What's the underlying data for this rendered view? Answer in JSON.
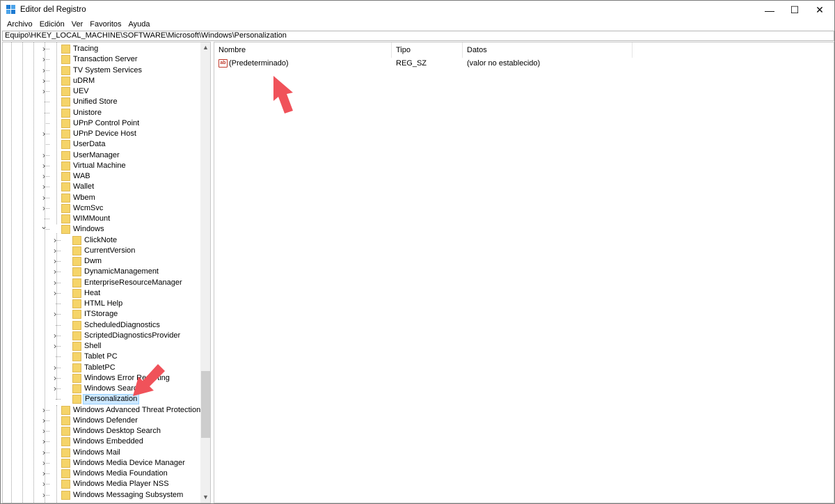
{
  "window": {
    "title": "Editor del Registro",
    "minimize_glyph": "—",
    "maximize_glyph": "☐",
    "close_glyph": "✕"
  },
  "menu": [
    "Archivo",
    "Edición",
    "Ver",
    "Favoritos",
    "Ayuda"
  ],
  "address": "Equipo\\HKEY_LOCAL_MACHINE\\SOFTWARE\\Microsoft\\Windows\\Personalization",
  "tree": {
    "items": [
      {
        "label": "Tracing",
        "level": 1,
        "expandable": true
      },
      {
        "label": "Transaction Server",
        "level": 1,
        "expandable": true
      },
      {
        "label": "TV System Services",
        "level": 1,
        "expandable": true
      },
      {
        "label": "uDRM",
        "level": 1,
        "expandable": true
      },
      {
        "label": "UEV",
        "level": 1,
        "expandable": true
      },
      {
        "label": "Unified Store",
        "level": 1,
        "expandable": false
      },
      {
        "label": "Unistore",
        "level": 1,
        "expandable": false
      },
      {
        "label": "UPnP Control Point",
        "level": 1,
        "expandable": false
      },
      {
        "label": "UPnP Device Host",
        "level": 1,
        "expandable": true
      },
      {
        "label": "UserData",
        "level": 1,
        "expandable": false
      },
      {
        "label": "UserManager",
        "level": 1,
        "expandable": true
      },
      {
        "label": "Virtual Machine",
        "level": 1,
        "expandable": true
      },
      {
        "label": "WAB",
        "level": 1,
        "expandable": true
      },
      {
        "label": "Wallet",
        "level": 1,
        "expandable": true
      },
      {
        "label": "Wbem",
        "level": 1,
        "expandable": true
      },
      {
        "label": "WcmSvc",
        "level": 1,
        "expandable": true
      },
      {
        "label": "WIMMount",
        "level": 1,
        "expandable": false
      },
      {
        "label": "Windows",
        "level": 1,
        "expandable": true,
        "expanded": true
      },
      {
        "label": "ClickNote",
        "level": 2,
        "expandable": true
      },
      {
        "label": "CurrentVersion",
        "level": 2,
        "expandable": true
      },
      {
        "label": "Dwm",
        "level": 2,
        "expandable": true
      },
      {
        "label": "DynamicManagement",
        "level": 2,
        "expandable": true
      },
      {
        "label": "EnterpriseResourceManager",
        "level": 2,
        "expandable": true
      },
      {
        "label": "Heat",
        "level": 2,
        "expandable": true
      },
      {
        "label": "HTML Help",
        "level": 2,
        "expandable": false
      },
      {
        "label": "ITStorage",
        "level": 2,
        "expandable": true
      },
      {
        "label": "ScheduledDiagnostics",
        "level": 2,
        "expandable": false
      },
      {
        "label": "ScriptedDiagnosticsProvider",
        "level": 2,
        "expandable": true
      },
      {
        "label": "Shell",
        "level": 2,
        "expandable": true
      },
      {
        "label": "Tablet PC",
        "level": 2,
        "expandable": false
      },
      {
        "label": "TabletPC",
        "level": 2,
        "expandable": true
      },
      {
        "label": "Windows Error Reporting",
        "level": 2,
        "expandable": true
      },
      {
        "label": "Windows Search",
        "level": 2,
        "expandable": true
      },
      {
        "label": "Personalization",
        "level": 2,
        "expandable": false,
        "selected": true
      },
      {
        "label": "Windows Advanced Threat Protection",
        "level": 1,
        "expandable": true
      },
      {
        "label": "Windows Defender",
        "level": 1,
        "expandable": true
      },
      {
        "label": "Windows Desktop Search",
        "level": 1,
        "expandable": true
      },
      {
        "label": "Windows Embedded",
        "level": 1,
        "expandable": true
      },
      {
        "label": "Windows Mail",
        "level": 1,
        "expandable": true
      },
      {
        "label": "Windows Media Device Manager",
        "level": 1,
        "expandable": true
      },
      {
        "label": "Windows Media Foundation",
        "level": 1,
        "expandable": true
      },
      {
        "label": "Windows Media Player NSS",
        "level": 1,
        "expandable": true
      },
      {
        "label": "Windows Messaging Subsystem",
        "level": 1,
        "expandable": true
      }
    ]
  },
  "list": {
    "columns": [
      "Nombre",
      "Tipo",
      "Datos"
    ],
    "rows": [
      {
        "name": "(Predeterminado)",
        "type": "REG_SZ",
        "data": "(valor no establecido)",
        "icon": "string-value-icon",
        "icon_text": "ab"
      }
    ]
  },
  "colors": {
    "folder": "#f5d469",
    "folder_edge": "#d9ad3c",
    "selection": "#cce8ff",
    "annotation_arrow": "#f0525a"
  }
}
